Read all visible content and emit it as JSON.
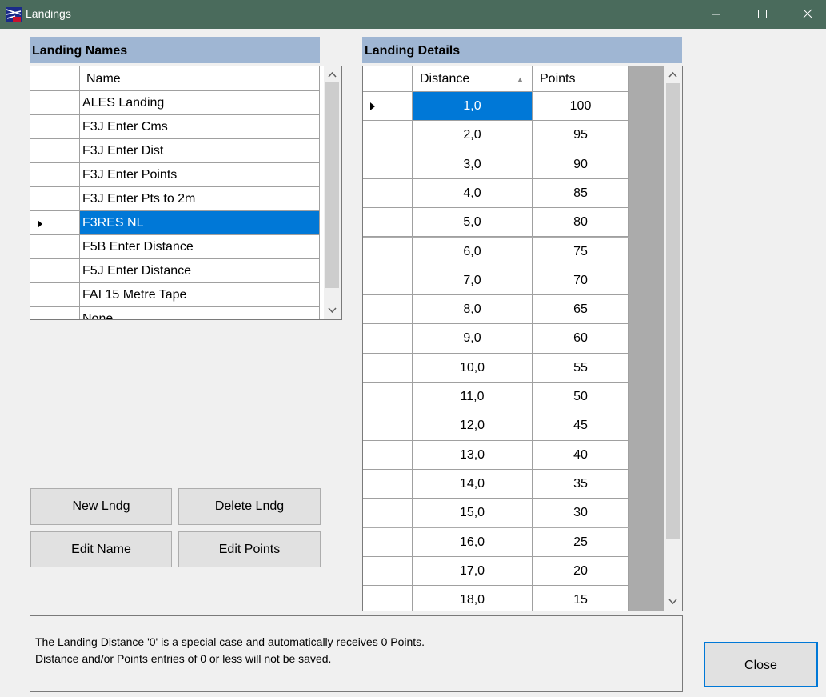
{
  "window": {
    "title": "Landings",
    "minimize": "—",
    "maximize": "☐",
    "close": "✕"
  },
  "names_panel": {
    "header": "Landing Names",
    "column": "Name",
    "rows": [
      {
        "name": "ALES Landing",
        "selected": false
      },
      {
        "name": "F3J Enter Cms",
        "selected": false
      },
      {
        "name": "F3J Enter Dist",
        "selected": false
      },
      {
        "name": "F3J Enter Points",
        "selected": false
      },
      {
        "name": "F3J Enter Pts to 2m",
        "selected": false
      },
      {
        "name": "F3RES NL",
        "selected": true
      },
      {
        "name": "F5B Enter Distance",
        "selected": false
      },
      {
        "name": "F5J Enter Distance",
        "selected": false
      },
      {
        "name": "FAI 15 Metre Tape",
        "selected": false
      },
      {
        "name": "None",
        "selected": false
      }
    ]
  },
  "details_panel": {
    "header": "Landing Details",
    "col_distance": "Distance",
    "col_points": "Points",
    "sort_icon": "▲",
    "rows": [
      {
        "distance": "1,0",
        "points": "100"
      },
      {
        "distance": "2,0",
        "points": "95"
      },
      {
        "distance": "3,0",
        "points": "90"
      },
      {
        "distance": "4,0",
        "points": "85"
      },
      {
        "distance": "5,0",
        "points": "80"
      },
      {
        "distance": "6,0",
        "points": "75"
      },
      {
        "distance": "7,0",
        "points": "70"
      },
      {
        "distance": "8,0",
        "points": "65"
      },
      {
        "distance": "9,0",
        "points": "60"
      },
      {
        "distance": "10,0",
        "points": "55"
      },
      {
        "distance": "11,0",
        "points": "50"
      },
      {
        "distance": "12,0",
        "points": "45"
      },
      {
        "distance": "13,0",
        "points": "40"
      },
      {
        "distance": "14,0",
        "points": "35"
      },
      {
        "distance": "15,0",
        "points": "30"
      },
      {
        "distance": "16,0",
        "points": "25"
      },
      {
        "distance": "17,0",
        "points": "20"
      },
      {
        "distance": "18,0",
        "points": "15"
      }
    ]
  },
  "buttons": {
    "new": "New Lndg",
    "delete": "Delete Lndg",
    "edit_name": "Edit Name",
    "edit_points": "Edit Points",
    "close": "Close"
  },
  "info": {
    "line1": "The Landing Distance '0' is a special case and automatically receives 0 Points.",
    "line2": "Distance and/or Points entries of 0 or less will not be saved."
  },
  "colors": {
    "titlebar": "#4a6b5c",
    "header": "#9fb6d3",
    "selection": "#0078d7"
  }
}
